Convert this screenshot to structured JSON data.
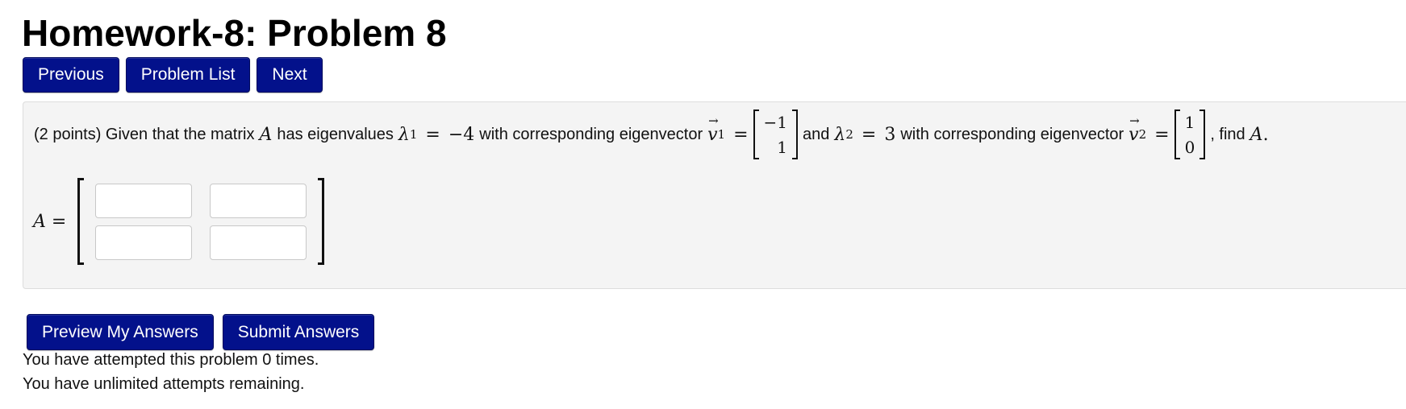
{
  "title": "Homework-8: Problem 8",
  "nav": {
    "previous": "Previous",
    "problem_list": "Problem List",
    "next": "Next"
  },
  "problem": {
    "intro": "(2 points) Given that the matrix",
    "matrix_name": "A",
    "has_eigenvalues": "has eigenvalues",
    "lambda1_symbol": "λ",
    "lambda1_sub": "1",
    "lambda1_value": "−4",
    "with_corresponding_1": "with corresponding eigenvector",
    "v1_symbol": "v",
    "v1_sub": "1",
    "v1_entries": [
      "−1",
      "1"
    ],
    "and": "and",
    "lambda2_symbol": "λ",
    "lambda2_sub": "2",
    "lambda2_value": "3",
    "with_corresponding_2": "with corresponding eigenvector",
    "v2_symbol": "v",
    "v2_sub": "2",
    "v2_entries": [
      "1",
      "0"
    ],
    "find": ", find",
    "find_target": "A",
    "equals": "=",
    "vec_arrow": "→",
    "period": "."
  },
  "answer": {
    "label": "A",
    "equals": "=",
    "a11": "",
    "a12": "",
    "a21": "",
    "a22": ""
  },
  "actions": {
    "preview": "Preview My Answers",
    "submit": "Submit Answers"
  },
  "status": {
    "attempts": "You have attempted this problem 0 times.",
    "remaining": "You have unlimited attempts remaining."
  },
  "colors": {
    "button_bg": "#03118b",
    "panel_bg": "#f4f4f4"
  }
}
